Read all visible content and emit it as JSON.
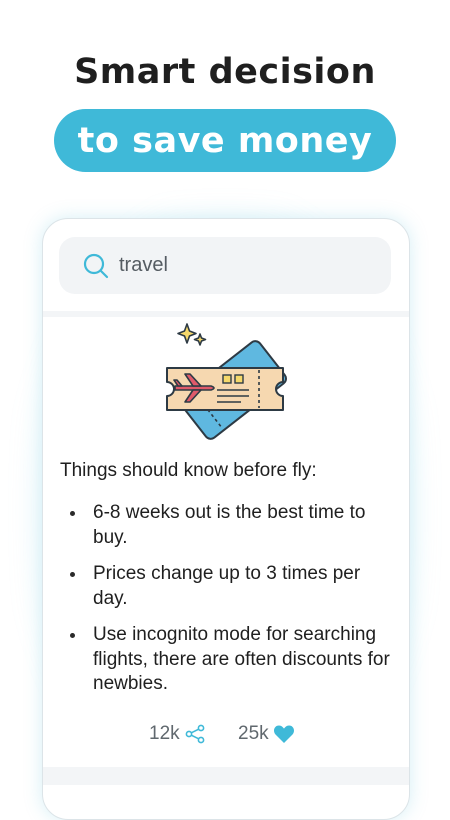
{
  "headline": {
    "line1": "Smart decision",
    "line2": "to save money"
  },
  "search": {
    "query": "travel"
  },
  "article": {
    "title": "Things should know before fly:",
    "tips": [
      "6-8 weeks out is the best time to buy.",
      "Prices change up to 3 times per day.",
      "Use incognito mode for searching flights, there are often discounts for newbies."
    ]
  },
  "stats": {
    "shares": "12k",
    "likes": "25k"
  },
  "colors": {
    "accent": "#3fb9d8",
    "heart": "#3fb9d8"
  },
  "icons": {
    "search": "search-icon",
    "share": "share-icon",
    "like": "heart-icon",
    "illustration": "plane-ticket-illustration"
  }
}
